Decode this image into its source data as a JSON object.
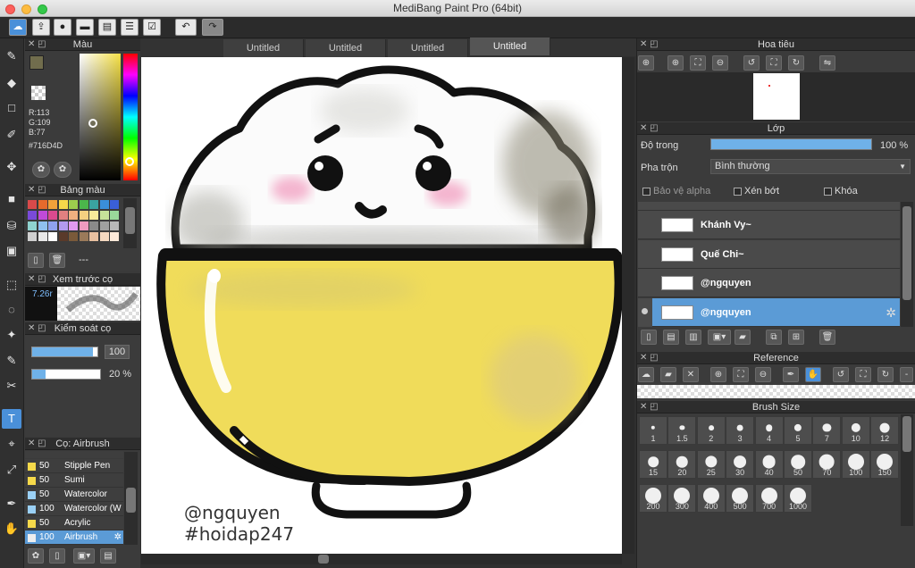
{
  "window": {
    "title": "MediBang Paint Pro (64bit)"
  },
  "toolbar": {
    "buttons": [
      "cloud-icon",
      "share-icon",
      "chat-icon",
      "comment-icon",
      "document-icon",
      "list-icon",
      "checklist-icon"
    ],
    "undo_icon": "undo-icon",
    "redo_icon": "redo-icon"
  },
  "tabs": [
    {
      "label": "Untitled",
      "active": false
    },
    {
      "label": "Untitled",
      "active": false
    },
    {
      "label": "Untitled",
      "active": false
    },
    {
      "label": "Untitled",
      "active": true
    }
  ],
  "color_panel": {
    "title": "Màu",
    "r": "R:113",
    "g": "G:109",
    "b": "B:77",
    "hex": "#716D4D",
    "current_color": "#716D4D"
  },
  "palette_panel": {
    "title": "Bảng màu",
    "footer": "---"
  },
  "brush_preview": {
    "title": "Xem trước cọ",
    "size": "7.26r"
  },
  "brush_control": {
    "title": "Kiểm soát cọ",
    "size_value": "100",
    "opacity_value": "20 %"
  },
  "brush_list": {
    "title": "Cọ: Airbrush",
    "items": [
      {
        "num": "50",
        "name": "Stipple Pen",
        "color": "yellow"
      },
      {
        "num": "50",
        "name": "Sumi",
        "color": "yellow"
      },
      {
        "num": "50",
        "name": "Watercolor",
        "color": "blue"
      },
      {
        "num": "100",
        "name": "Watercolor (W",
        "color": "blue"
      },
      {
        "num": "50",
        "name": "Acrylic",
        "color": "yellow"
      },
      {
        "num": "100",
        "name": "Airbrush",
        "color": "white",
        "selected": true
      }
    ]
  },
  "canvas": {
    "watermark_line1": "@ngquyen",
    "watermark_line2": "#hoidap247"
  },
  "navigator": {
    "title": "Hoa tiêu"
  },
  "layers": {
    "title": "Lớp",
    "opacity_label": "Độ trong",
    "opacity_value": "100 %",
    "blend_label": "Pha trộn",
    "blend_value": "Bình thường",
    "protect_alpha": "Bảo vệ alpha",
    "clipping": "Xén bớt",
    "lock": "Khóa",
    "items": [
      {
        "name": "Khánh Vy~",
        "selected": false
      },
      {
        "name": "Quế Chi~",
        "selected": false
      },
      {
        "name": "@ngquyen",
        "selected": false
      },
      {
        "name": "@ngquyen",
        "selected": true
      }
    ]
  },
  "reference": {
    "title": "Reference"
  },
  "brush_size": {
    "title": "Brush Size",
    "sizes": [
      "1",
      "1.5",
      "2",
      "3",
      "4",
      "5",
      "7",
      "10",
      "12",
      "15",
      "20",
      "25",
      "30",
      "40",
      "50",
      "70",
      "100",
      "150",
      "200",
      "300",
      "400",
      "500",
      "700",
      "1000"
    ]
  },
  "colors": {
    "accent": "#5b9bd6",
    "rice_bowl_yellow": "#f0dc5a",
    "blush": "#f4b5cf"
  }
}
